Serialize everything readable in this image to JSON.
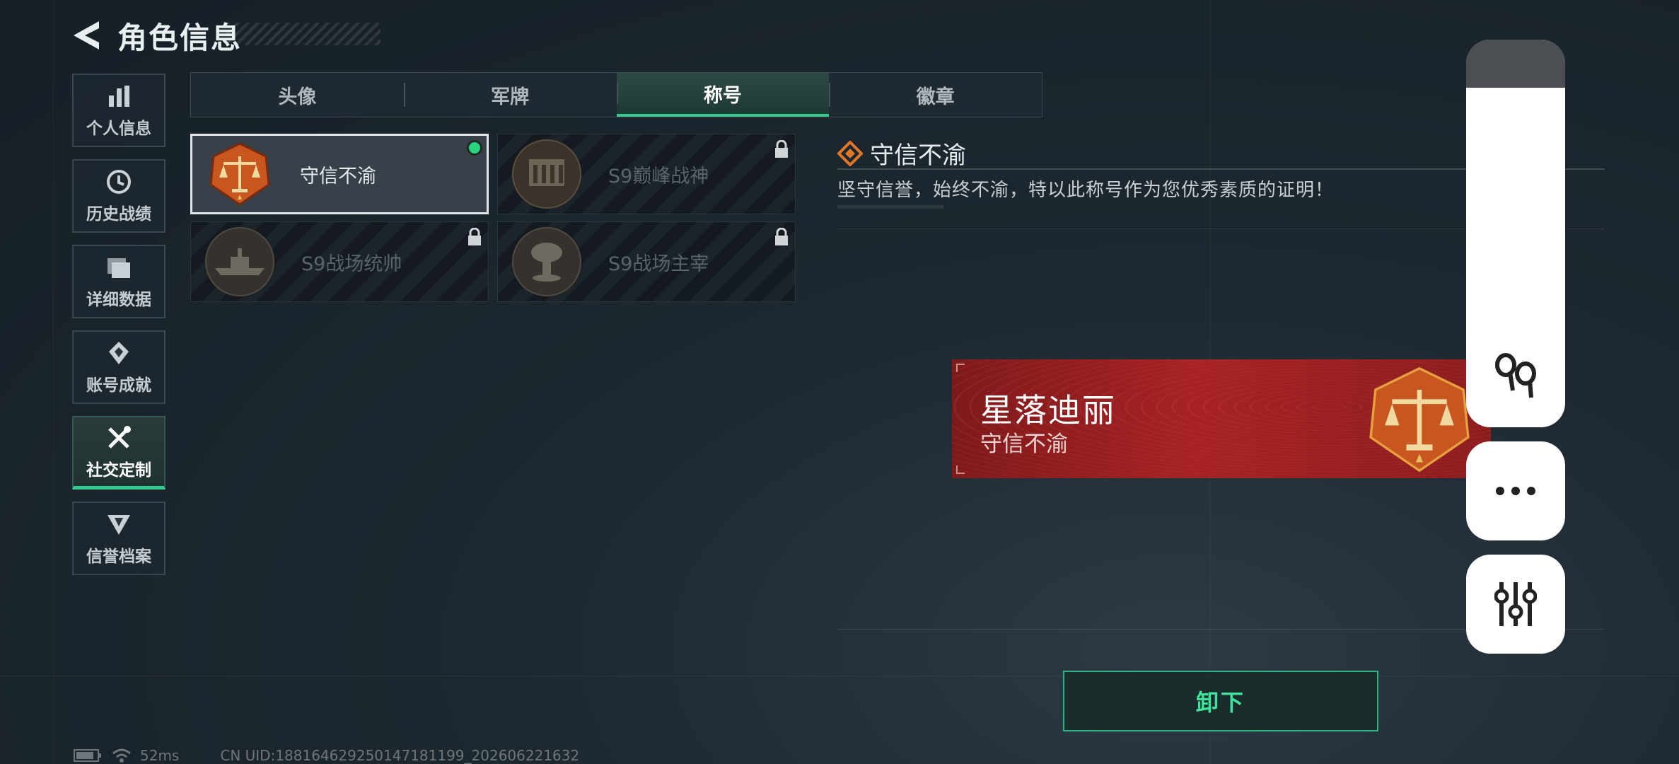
{
  "header": {
    "title": "角色信息"
  },
  "sidebar": {
    "items": [
      {
        "label": "个人信息",
        "icon": "bar-chart-icon",
        "active": false
      },
      {
        "label": "历史战绩",
        "icon": "history-icon",
        "active": false
      },
      {
        "label": "详细数据",
        "icon": "folder-icon",
        "active": false
      },
      {
        "label": "账号成就",
        "icon": "achievement-icon",
        "active": false
      },
      {
        "label": "社交定制",
        "icon": "tools-icon",
        "active": true
      },
      {
        "label": "信誉档案",
        "icon": "credit-icon",
        "active": false
      }
    ]
  },
  "tabs": [
    {
      "label": "头像",
      "active": false
    },
    {
      "label": "军牌",
      "active": false
    },
    {
      "label": "称号",
      "active": true
    },
    {
      "label": "徽章",
      "active": false
    }
  ],
  "titles": [
    {
      "name": "守信不渝",
      "selected": true,
      "locked": false,
      "equipped": true,
      "icon": "scales-emblem-icon"
    },
    {
      "name": "S9巅峰战神",
      "selected": false,
      "locked": true,
      "equipped": false,
      "icon": "fortress-emblem-icon"
    },
    {
      "name": "S9战场统帅",
      "selected": false,
      "locked": true,
      "equipped": false,
      "icon": "warship-emblem-icon"
    },
    {
      "name": "S9战场主宰",
      "selected": false,
      "locked": true,
      "equipped": false,
      "icon": "mushroom-cloud-emblem-icon"
    }
  ],
  "detail": {
    "title": "守信不渝",
    "description": "坚守信誉，始终不渝，特以此称号作为您优秀素质的证明！"
  },
  "nameplate": {
    "player_name": "星落迪丽",
    "title": "守信不渝"
  },
  "actions": {
    "unequip_label": "卸下"
  },
  "status": {
    "ping": "52ms",
    "uid": "CN UID:18816462925014718­1199_202606221632"
  },
  "colors": {
    "accent_green": "#34c98f",
    "equipped_dot": "#2bd47e",
    "nameplate_red": "#a72224",
    "emblem_orange": "#c8561f"
  }
}
